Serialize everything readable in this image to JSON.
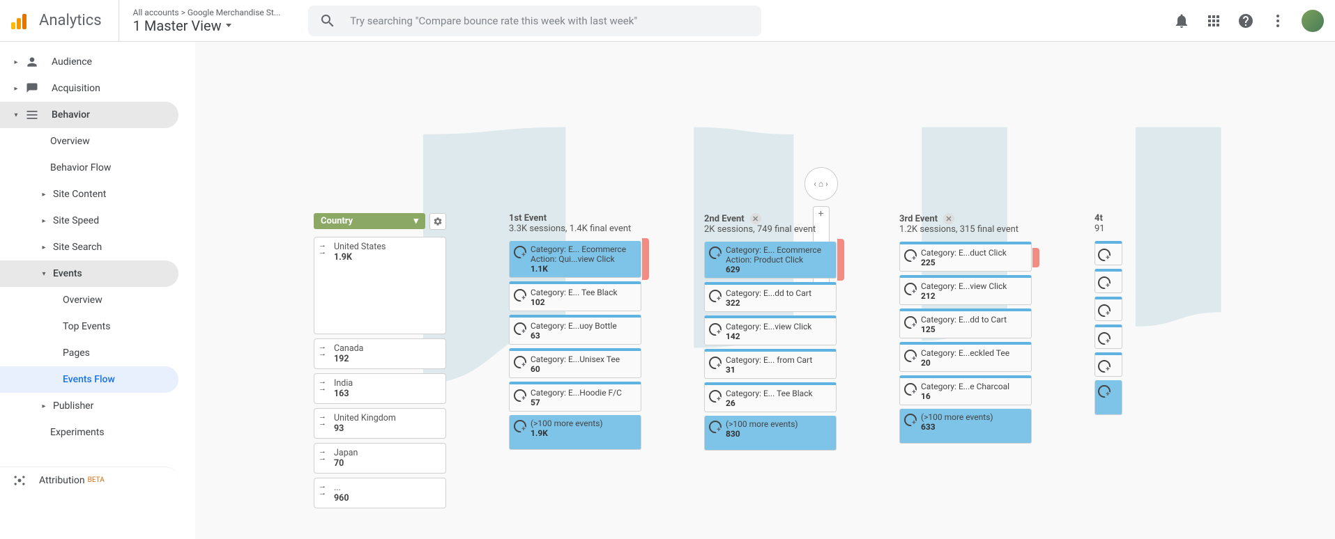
{
  "header": {
    "title": "Analytics",
    "account_crumb": "All accounts > Google Merchandise St...",
    "account_main": "1 Master View",
    "search_placeholder": "Try searching \"Compare bounce rate this week with last week\""
  },
  "sidebar": {
    "audience": "Audience",
    "acquisition": "Acquisition",
    "behavior": "Behavior",
    "overview": "Overview",
    "behavior_flow": "Behavior Flow",
    "site_content": "Site Content",
    "site_speed": "Site Speed",
    "site_search": "Site Search",
    "events": "Events",
    "events_overview": "Overview",
    "top_events": "Top Events",
    "pages": "Pages",
    "events_flow": "Events Flow",
    "publisher": "Publisher",
    "experiments": "Experiments",
    "attribution": "Attribution",
    "beta": "BETA"
  },
  "flow": {
    "dimension": "Country",
    "countries": [
      {
        "name": "United States",
        "val": "1.9K"
      },
      {
        "name": "Canada",
        "val": "192"
      },
      {
        "name": "India",
        "val": "163"
      },
      {
        "name": "United Kingdom",
        "val": "93"
      },
      {
        "name": "Japan",
        "val": "70"
      },
      {
        "name": "...",
        "val": "960"
      }
    ],
    "columns": [
      {
        "title": "1st Event",
        "subtitle": "3.3K sessions, 1.4K final event",
        "closable": false,
        "events": [
          {
            "label": "Category: E... Ecommerce Action: Qui...view Click",
            "val": "1.1K",
            "highlight": true,
            "drop": true
          },
          {
            "label": "Category: E... Tee Black",
            "val": "102"
          },
          {
            "label": "Category: E...uoy Bottle",
            "val": "63"
          },
          {
            "label": "Category: E...Unisex Tee",
            "val": "60"
          },
          {
            "label": "Category: E...Hoodie F/C",
            "val": "57"
          },
          {
            "label": "(>100 more events)",
            "val": "1.9K",
            "more": true
          }
        ]
      },
      {
        "title": "2nd Event",
        "subtitle": "2K sessions, 749 final event",
        "closable": true,
        "events": [
          {
            "label": "Category: E... Ecommerce Action: Product Click",
            "val": "629",
            "highlight": true,
            "drop": true
          },
          {
            "label": "Category: E...dd to Cart",
            "val": "322"
          },
          {
            "label": "Category: E...view Click",
            "val": "142"
          },
          {
            "label": "Category: E... from Cart",
            "val": "31"
          },
          {
            "label": "Category: E... Tee Black",
            "val": "26"
          },
          {
            "label": "(>100 more events)",
            "val": "830",
            "more": true
          }
        ]
      },
      {
        "title": "3rd Event",
        "subtitle": "1.2K sessions, 315 final event",
        "closable": true,
        "events": [
          {
            "label": "Category: E...duct Click",
            "val": "225",
            "drop": true
          },
          {
            "label": "Category: E...view Click",
            "val": "212"
          },
          {
            "label": "Category: E...dd to Cart",
            "val": "125"
          },
          {
            "label": "Category: E...eckled Tee",
            "val": "20"
          },
          {
            "label": "Category: E...e Charcoal",
            "val": "16"
          },
          {
            "label": "(>100 more events)",
            "val": "633",
            "more": true
          }
        ]
      }
    ],
    "partial": {
      "title": "4t",
      "sub": "91"
    }
  }
}
